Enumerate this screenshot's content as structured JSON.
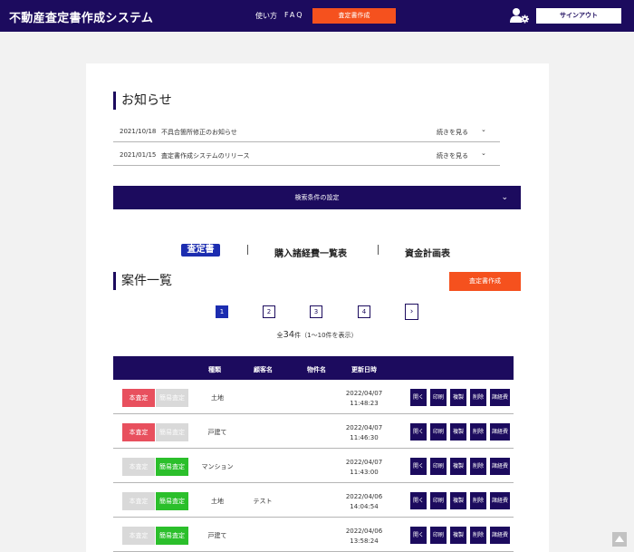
{
  "header": {
    "app_title": "不動産査定書作成システム",
    "nav_usage": "使い方",
    "nav_faq": "FAQ",
    "create_button": "査定書作成",
    "signout_button": "サインアウト"
  },
  "news": {
    "heading": "お知らせ",
    "items": [
      {
        "date": "2021/10/18",
        "title": "不具合箇所修正のお知らせ",
        "more": "続きを見る"
      },
      {
        "date": "2021/01/15",
        "title": "査定書作成システムのリリース",
        "more": "続きを見る"
      }
    ]
  },
  "search": {
    "label": "検索条件の設定"
  },
  "tabs": [
    "査定書",
    "購入諸経費一覧表",
    "資金計画表"
  ],
  "cases": {
    "heading": "案件一覧",
    "create_button": "査定書作成",
    "pages": [
      "1",
      "2",
      "3",
      "4"
    ],
    "next_icon": "›",
    "count_prefix": "全",
    "count_total": "34",
    "count_suffix": "件（1〜10件を表示）"
  },
  "table": {
    "headers": {
      "type": "種類",
      "client": "顧客名",
      "property": "物件名",
      "updated": "更新日時"
    },
    "badge_main": "本査定",
    "badge_simple": "簡易査定",
    "actions": [
      "開く",
      "印刷",
      "複製",
      "削除",
      "諸経費"
    ],
    "rows": [
      {
        "type": "土地",
        "client": "",
        "property": "",
        "date": "2022/04/07",
        "time": "11:48:23",
        "active": "main"
      },
      {
        "type": "戸建て",
        "client": "",
        "property": "",
        "date": "2022/04/07",
        "time": "11:46:30",
        "active": "main"
      },
      {
        "type": "マンション",
        "client": "",
        "property": "",
        "date": "2022/04/07",
        "time": "11:43:00",
        "active": "simple"
      },
      {
        "type": "土地",
        "client": "テスト",
        "property": "",
        "date": "2022/04/06",
        "time": "14:04:54",
        "active": "simple"
      },
      {
        "type": "戸建て",
        "client": "",
        "property": "",
        "date": "2022/04/06",
        "time": "13:58:24",
        "active": "simple"
      }
    ]
  },
  "colors": {
    "navy": "#1c0b5e",
    "orange": "#f5511e",
    "tab_active": "#1c2db0",
    "red_badge": "#e8505e",
    "green_badge": "#2bbf2b"
  },
  "icons": {
    "user_settings": "user-gear-icon",
    "chevron": "chevron-down-icon",
    "scroll_top": "arrow-up-icon"
  }
}
